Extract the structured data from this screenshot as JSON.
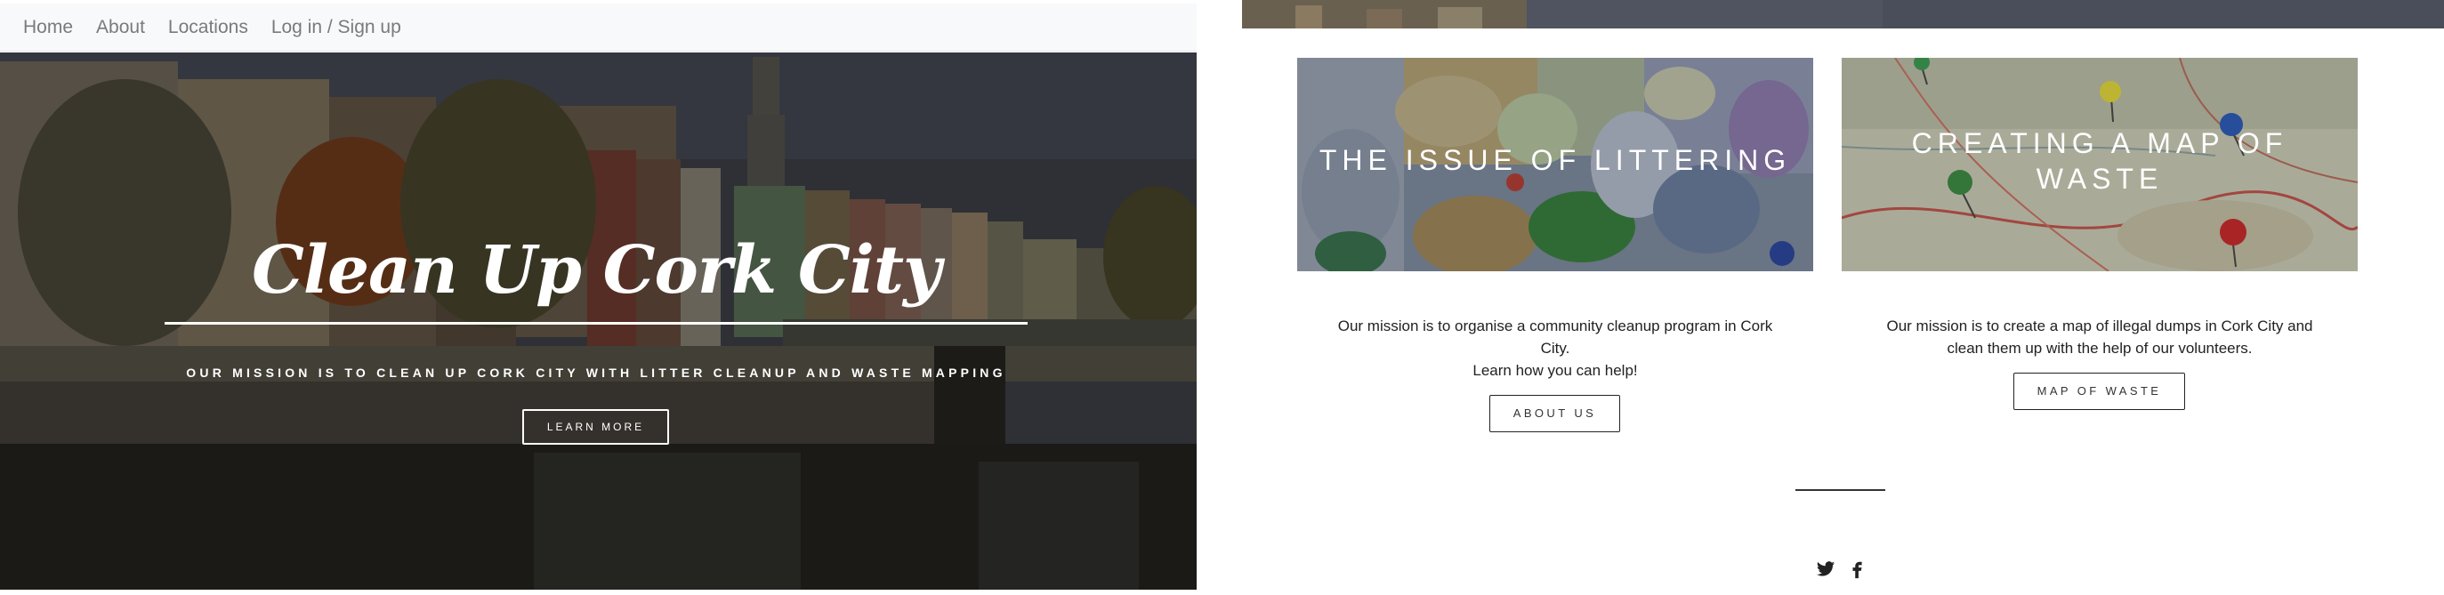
{
  "nav": {
    "links": [
      "Home",
      "About",
      "Locations",
      "Log in / Sign up"
    ]
  },
  "hero": {
    "title": "Clean Up Cork City",
    "subtitle": "Our mission is to clean up Cork City with litter cleanup and waste mapping",
    "button_label": "LEARN MORE"
  },
  "cards": [
    {
      "title": "THE ISSUE OF LITTERING",
      "description_lines": [
        "Our mission is to organise a community cleanup program in Cork",
        "City.",
        "Learn how you can help!"
      ],
      "button_label": "ABOUT US"
    },
    {
      "title": "CREATING A MAP OF WASTE",
      "description_lines": [
        "Our mission is to create a map of illegal dumps in Cork City and",
        "clean them up with the help of our volunteers."
      ],
      "button_label": "MAP OF WASTE"
    }
  ],
  "footer": {
    "social": [
      "twitter-icon",
      "facebook-icon"
    ]
  },
  "colors": {
    "nav_bg": "#f8f9fa",
    "nav_text": "#7a7a7a",
    "hero_text": "#ffffff",
    "body_text": "#222222",
    "button_border": "#222222"
  }
}
